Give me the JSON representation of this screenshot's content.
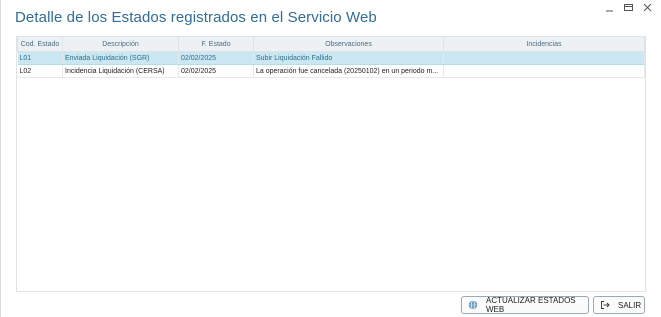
{
  "window": {
    "title": "Detalle de los Estados registrados en el Servicio Web"
  },
  "table": {
    "columns": [
      "Cod. Estado",
      "Descripción",
      "F. Estado",
      "Observaciones",
      "Incidencias"
    ],
    "rows": [
      {
        "code": "L01",
        "description": "Enviada Liquidación (SGR)",
        "date": "02/02/2025",
        "observations": "Subir Liquidación Fallido",
        "incidents": ""
      },
      {
        "code": "L02",
        "description": "Incidencia Liquidación (CERSA)",
        "date": "02/02/2025",
        "observations": "La operación fue cancelada (20250102) en un periodo m...",
        "incidents": ""
      }
    ]
  },
  "buttons": {
    "update_label": "ACTUALIZAR ESTADOS WEB",
    "exit_label": "SALIR"
  },
  "colors": {
    "title": "#2f6d9a",
    "selected_row": "#cbe7f1",
    "header_bg": "#eef1f3"
  }
}
